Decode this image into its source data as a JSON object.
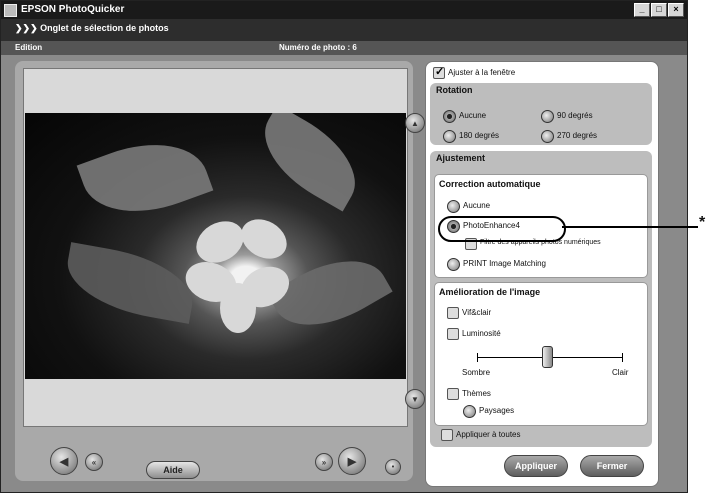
{
  "window": {
    "title": "EPSON PhotoQuicker",
    "controls": [
      "_",
      "□",
      "×"
    ]
  },
  "subbar": {
    "tab": "❯❯❯  Onglet de sélection de photos"
  },
  "status": {
    "edition": "Edition",
    "photo_number": "Numéro de photo : 6"
  },
  "fit_window": {
    "label": "Ajuster à la fenêtre",
    "checked": true
  },
  "rotation": {
    "title": "Rotation",
    "options": [
      "Aucune",
      "90 degrés",
      "180 degrés",
      "270 degrés"
    ],
    "selected": "Aucune"
  },
  "adjustment": {
    "title": "Ajustement",
    "auto_correction": {
      "title": "Correction automatique",
      "options": [
        "Aucune",
        "PhotoEnhance4",
        "PRINT Image Matching"
      ],
      "selected": "PhotoEnhance4",
      "digital_camera_filter": "Filtre des appareils photos numériques"
    },
    "improvement": {
      "title": "Amélioration de l'image",
      "vivid": "Vif&clair",
      "brightness": "Luminosité",
      "dark": "Sombre",
      "light": "Clair",
      "themes": "Thèmes",
      "landscape": "Paysages"
    }
  },
  "apply_all": "Appliquer à toutes",
  "buttons": {
    "help": "Aide",
    "apply": "Appliquer",
    "close": "Fermer"
  },
  "callout_marker": "*",
  "icons": [
    "app-icon",
    "arrow-left-icon",
    "rewind-icon",
    "arrow-right-icon",
    "forward-icon",
    "scroll-up-icon",
    "scroll-down-icon"
  ]
}
